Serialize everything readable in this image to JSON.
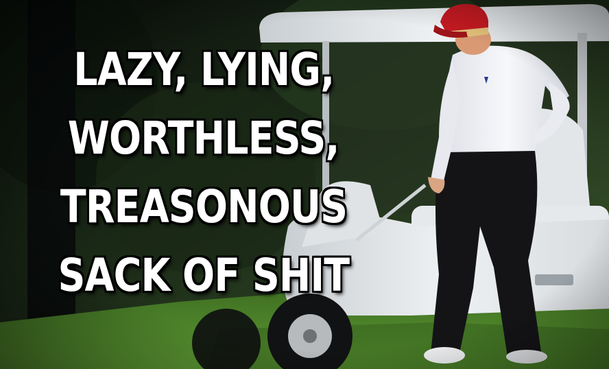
{
  "meme": {
    "caption_lines": [
      "LAZY, LYING,",
      "WORTHLESS,",
      "TREASONOUS",
      "SACK OF SHIT"
    ]
  },
  "colors": {
    "caption_text": "#ffffff",
    "caption_outline": "#000000",
    "foliage_dark": "#0c120c",
    "grass": "#4f8a2a",
    "cart_white": "#e9ecee",
    "cap_red": "#c41a22",
    "shirt_white": "#f1f2f6",
    "trousers": "#151518"
  },
  "icons": {
    "scene": "photo-man-walking-past-golf-cart"
  }
}
